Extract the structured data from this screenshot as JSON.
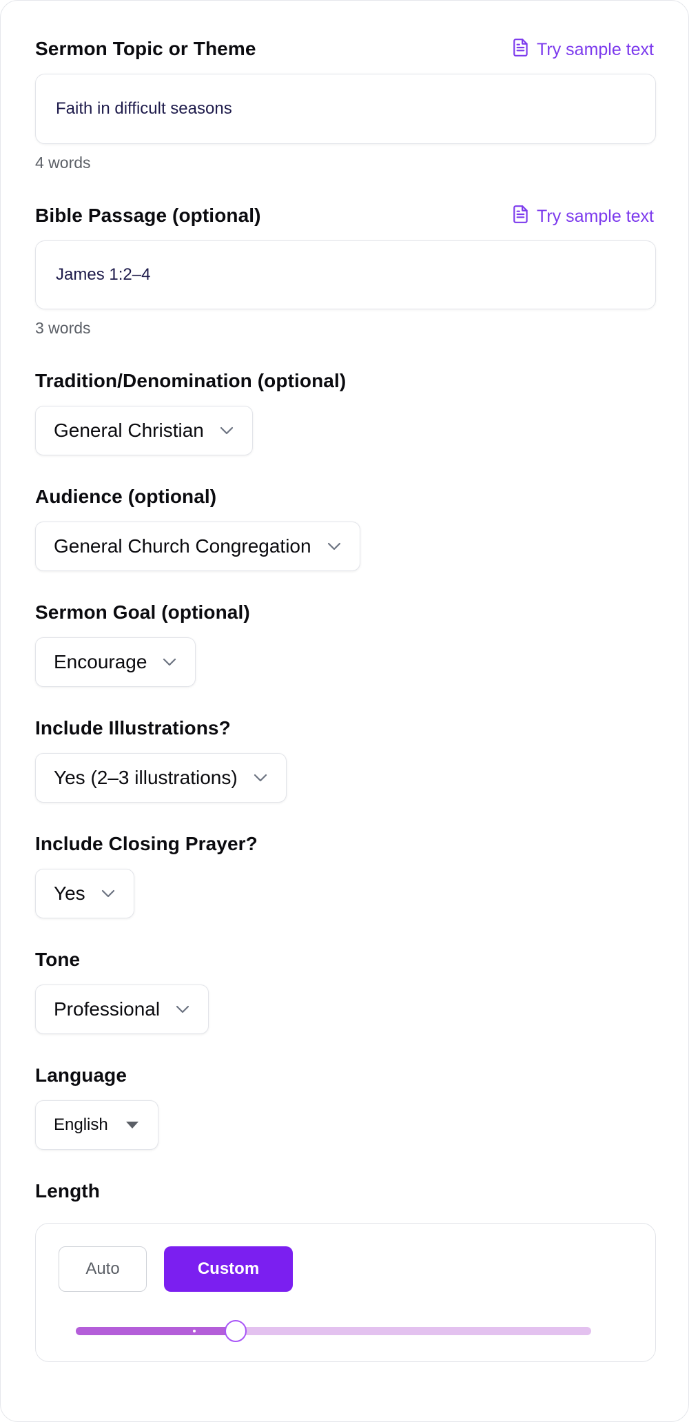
{
  "topic": {
    "label": "Sermon Topic or Theme",
    "sample_label": "Try sample text",
    "value": "Faith in difficult seasons",
    "word_count": "4 words"
  },
  "passage": {
    "label": "Bible Passage (optional)",
    "sample_label": "Try sample text",
    "value": "James 1:2–4",
    "word_count": "3 words"
  },
  "tradition": {
    "label": "Tradition/Denomination (optional)",
    "value": "General Christian"
  },
  "audience": {
    "label": "Audience (optional)",
    "value": "General Church Congregation"
  },
  "goal": {
    "label": "Sermon Goal (optional)",
    "value": "Encourage"
  },
  "illustrations": {
    "label": "Include Illustrations?",
    "value": "Yes (2–3 illustrations)"
  },
  "prayer": {
    "label": "Include Closing Prayer?",
    "value": "Yes"
  },
  "tone": {
    "label": "Tone",
    "value": "Professional"
  },
  "language": {
    "label": "Language",
    "value": "English"
  },
  "length": {
    "label": "Length",
    "auto_label": "Auto",
    "custom_label": "Custom",
    "selected_mode": "Custom",
    "slider_fraction": 0.31
  },
  "colors": {
    "accent": "#7c3aed",
    "custom_button": "#7b1ff0",
    "slider_fill": "#b45ed9",
    "slider_track": "#e3c1ef"
  }
}
